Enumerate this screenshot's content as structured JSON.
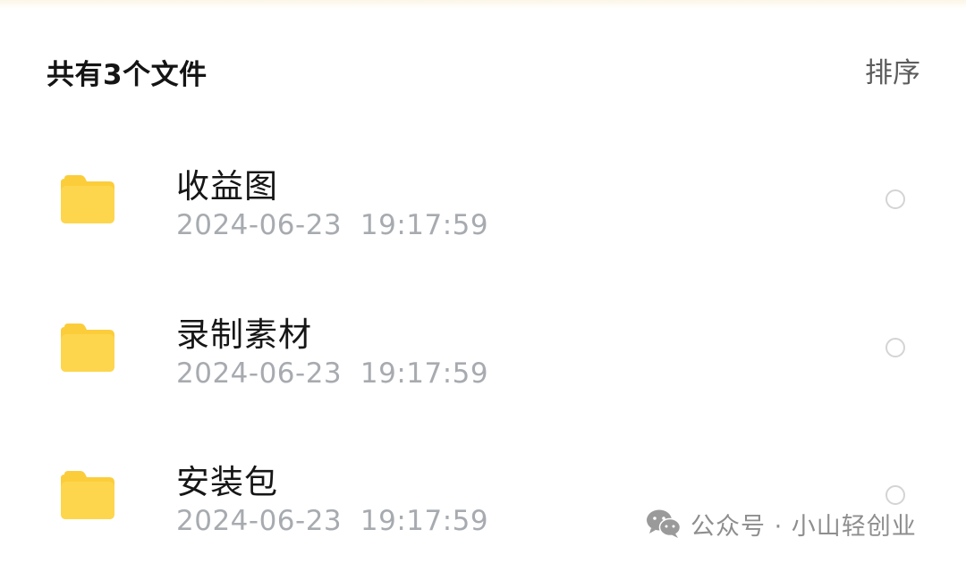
{
  "header": {
    "count_title": "共有3个文件",
    "sort_label": "排序"
  },
  "files": [
    {
      "name": "收益图",
      "date": "2024-06-23",
      "time": "19:17:59",
      "icon": "folder-icon",
      "selected": false
    },
    {
      "name": "录制素材",
      "date": "2024-06-23",
      "time": "19:17:59",
      "icon": "folder-icon",
      "selected": false
    },
    {
      "name": "安装包",
      "date": "2024-06-23",
      "time": "19:17:59",
      "icon": "folder-icon",
      "selected": false
    }
  ],
  "watermark": {
    "icon": "wechat-icon",
    "text": "公众号 · 小山轻创业"
  },
  "colors": {
    "folder": "#fdd64e",
    "folder_tab": "#fccd3a",
    "meta_text": "#a7abb0",
    "radio_border": "#d4d4d4"
  }
}
